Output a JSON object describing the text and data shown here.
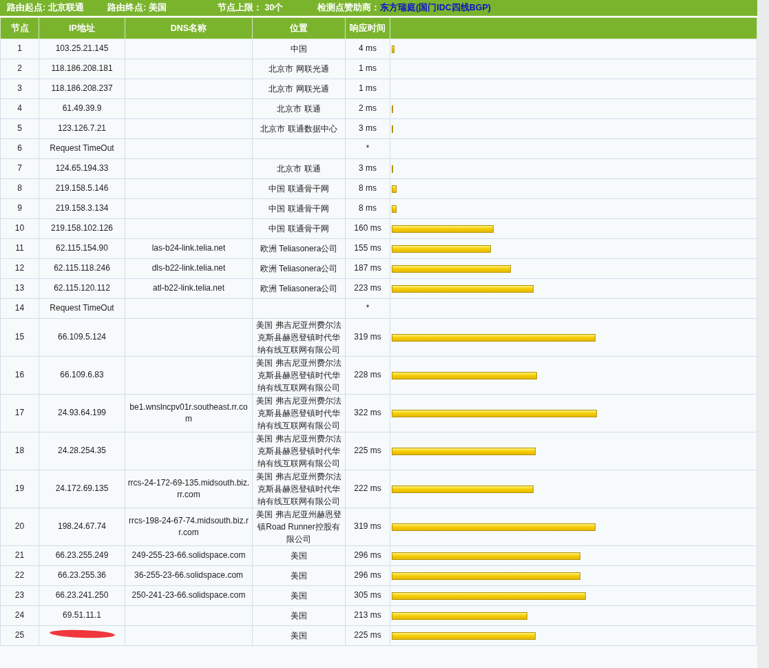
{
  "info_bar": {
    "items": [
      {
        "label": "路由起点:",
        "value": "北京联通"
      },
      {
        "label": "路由终点:",
        "value": "美国"
      },
      {
        "label": "节点上限：",
        "value": "30个"
      }
    ],
    "sponsor": {
      "label": "检测点赞助商：",
      "name": "东方瑞庭",
      "detail": "(国门IDC四线BGP)"
    }
  },
  "table": {
    "columns": [
      "节点",
      "IP地址",
      "DNS名称",
      "位置",
      "响应时间"
    ],
    "rows": [
      {
        "hop": "1",
        "ip": "103.25.21.145",
        "location": "中国",
        "time": "4 ms",
        "level": 0.007
      },
      {
        "hop": "2",
        "ip": "118.186.208.181",
        "location": "北京市 网联光通",
        "time": "1 ms"
      },
      {
        "hop": "3",
        "ip": "118.186.208.237",
        "location": "北京市 网联光通",
        "time": "1 ms"
      },
      {
        "hop": "4",
        "ip": "61.49.39.9",
        "location": "北京市 联通",
        "time": "2 ms",
        "level": 0.003
      },
      {
        "hop": "5",
        "ip": "123.126.7.21",
        "location": "北京市 联通数据中心",
        "time": "3 ms",
        "level": 0.004
      },
      {
        "hop": "6",
        "ip": "Request TimeOut",
        "time": "*"
      },
      {
        "hop": "7",
        "ip": "124.65.194.33",
        "location": "北京市 联通",
        "time": "3 ms",
        "level": 0.004
      },
      {
        "hop": "8",
        "ip": "219.158.5.146",
        "location": "中国 联通骨干网",
        "time": "8 ms",
        "level": 0.014
      },
      {
        "hop": "9",
        "ip": "219.158.3.134",
        "location": "中国 联通骨干网",
        "time": "8 ms",
        "level": 0.014
      },
      {
        "hop": "10",
        "ip": "219.158.102.126",
        "location": "中国 联通骨干网",
        "time": "160 ms",
        "level": 0.281
      },
      {
        "hop": "11",
        "ip": "62.115.154.90",
        "dns": "las-b24-link.telia.net",
        "location": "欧洲 Teliasonera公司",
        "time": "155 ms",
        "level": 0.272
      },
      {
        "hop": "12",
        "ip": "62.115.118.246",
        "dns": "dls-b22-link.telia.net",
        "location": "欧洲 Teliasonera公司",
        "time": "187 ms",
        "level": 0.328
      },
      {
        "hop": "13",
        "ip": "62.115.120.112",
        "dns": "atl-b22-link.telia.net",
        "location": "欧洲 Teliasonera公司",
        "time": "223 ms",
        "level": 0.391
      },
      {
        "hop": "14",
        "ip": "Request TimeOut",
        "time": "*"
      },
      {
        "hop": "15",
        "ip": "66.109.5.124",
        "location": "美国 弗吉尼亚州费尔法克斯县赫恩登镇时代华纳有线互联网有限公司",
        "time": "319 ms",
        "level": 0.56
      },
      {
        "hop": "16",
        "ip": "66.109.6.83",
        "location": "美国 弗吉尼亚州费尔法克斯县赫恩登镇时代华纳有线互联网有限公司",
        "time": "228 ms",
        "level": 0.4
      },
      {
        "hop": "17",
        "ip": "24.93.64.199",
        "dns": "be1.wnslncpv01r.southeast.rr.com",
        "location": "美国 弗吉尼亚州费尔法克斯县赫恩登镇时代华纳有线互联网有限公司",
        "time": "322 ms",
        "level": 0.565
      },
      {
        "hop": "18",
        "ip": "24.28.254.35",
        "location": "美国 弗吉尼亚州费尔法克斯县赫恩登镇时代华纳有线互联网有限公司",
        "time": "225 ms",
        "level": 0.395
      },
      {
        "hop": "19",
        "ip": "24.172.69.135",
        "dns": "rrcs-24-172-69-135.midsouth.biz.rr.com",
        "location": "美国 弗吉尼亚州费尔法克斯县赫恩登镇时代华纳有线互联网有限公司",
        "time": "222 ms",
        "level": 0.39
      },
      {
        "hop": "20",
        "ip": "198.24.67.74",
        "dns": "rrcs-198-24-67-74.midsouth.biz.rr.com",
        "location": "美国 弗吉尼亚州赫恩登镇Road Runner控股有限公司",
        "time": "319 ms",
        "level": 0.56
      },
      {
        "hop": "21",
        "ip": "66.23.255.249",
        "dns": "249-255-23-66.solidspace.com",
        "location": "美国",
        "time": "296 ms",
        "level": 0.519
      },
      {
        "hop": "22",
        "ip": "66.23.255.36",
        "dns": "36-255-23-66.solidspace.com",
        "location": "美国",
        "time": "296 ms",
        "level": 0.519
      },
      {
        "hop": "23",
        "ip": "66.23.241.250",
        "dns": "250-241-23-66.solidspace.com",
        "location": "美国",
        "time": "305 ms",
        "level": 0.535
      },
      {
        "hop": "24",
        "ip": "69.51.11.1",
        "location": "美国",
        "time": "213 ms",
        "level": 0.374
      },
      {
        "hop": "25",
        "redacted": true,
        "location": "美国",
        "time": "225 ms",
        "level": 0.395
      }
    ]
  }
}
